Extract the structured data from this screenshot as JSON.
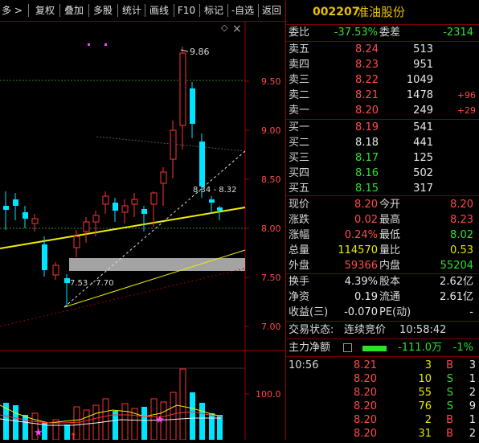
{
  "toolbar": {
    "items": [
      {
        "label": "多 >"
      },
      {
        "label": "复权"
      },
      {
        "label": "叠加"
      },
      {
        "label": "多股"
      },
      {
        "label": "统计"
      },
      {
        "label": "画线"
      },
      {
        "label": "F10"
      },
      {
        "label": "标记"
      },
      {
        "label": "-自选"
      },
      {
        "label": "返回"
      }
    ],
    "diamond_icon": "◇",
    "close_icon": "×"
  },
  "chart": {
    "price_axis": [
      "9.50",
      "9.00",
      "8.50",
      "8.00",
      "7.50",
      "7.00"
    ],
    "high_label": "9.86",
    "range_label": "8.34 - 8.32",
    "low_label": "7.53 - 7.70",
    "volume_axis": "100.0",
    "colors": {
      "up": "#ff3333",
      "down": "#00e5ff",
      "support": "#f0f000",
      "grid": "#2a7a2a"
    }
  },
  "stock": {
    "code": "002207",
    "name": "准油股份"
  },
  "weibi": {
    "label1": "委比",
    "value1": "-37.53%",
    "label2": "委差",
    "value2": "-2314"
  },
  "sell": [
    {
      "label": "卖五",
      "price": "8.24",
      "vol": "513",
      "chg": ""
    },
    {
      "label": "卖四",
      "price": "8.23",
      "vol": "951",
      "chg": ""
    },
    {
      "label": "卖三",
      "price": "8.22",
      "vol": "1049",
      "chg": ""
    },
    {
      "label": "卖二",
      "price": "8.21",
      "vol": "1478",
      "chg": "+96"
    },
    {
      "label": "卖一",
      "price": "8.20",
      "vol": "249",
      "chg": "+29"
    }
  ],
  "buy": [
    {
      "label": "买一",
      "price": "8.19",
      "vol": "541"
    },
    {
      "label": "买二",
      "price": "8.18",
      "vol": "441"
    },
    {
      "label": "买三",
      "price": "8.17",
      "vol": "125"
    },
    {
      "label": "买四",
      "price": "8.16",
      "vol": "502"
    },
    {
      "label": "买五",
      "price": "8.15",
      "vol": "317"
    }
  ],
  "quote": [
    {
      "l1": "现价",
      "v1": "8.20",
      "l2": "今开",
      "v2": "8.20"
    },
    {
      "l1": "涨跌",
      "v1": "0.02",
      "l2": "最高",
      "v2": "8.23"
    },
    {
      "l1": "涨幅",
      "v1": "0.24%",
      "l2": "最低",
      "v2": "8.02"
    },
    {
      "l1": "总量",
      "v1": "114570",
      "l2": "量比",
      "v2": "0.53"
    },
    {
      "l1": "外盘",
      "v1": "59366",
      "l2": "内盘",
      "v2": "55204"
    }
  ],
  "fund": [
    {
      "l1": "换手",
      "v1": "4.39%",
      "l2": "股本",
      "v2": "2.62亿"
    },
    {
      "l1": "净资",
      "v1": "0.19",
      "l2": "流通",
      "v2": "2.61亿"
    },
    {
      "l1": "收益(三)",
      "v1": "-0.070",
      "l2": "PE(动)",
      "v2": "-"
    }
  ],
  "status": {
    "label": "交易状态:",
    "value": "连续竞价",
    "time": "10:58:42"
  },
  "main_flow": {
    "label": "主力净额",
    "value": "-111.0万",
    "pct": "-1%"
  },
  "ticks": [
    {
      "time": "10:56",
      "price": "8.21",
      "vol": "3",
      "side": "B",
      "n": "3"
    },
    {
      "time": "",
      "price": "8.20",
      "vol": "10",
      "side": "S",
      "n": "1"
    },
    {
      "time": "",
      "price": "8.20",
      "vol": "55",
      "side": "S",
      "n": "2"
    },
    {
      "time": "",
      "price": "8.20",
      "vol": "76",
      "side": "S",
      "n": "9"
    },
    {
      "time": "",
      "price": "8.20",
      "vol": "2",
      "side": "B",
      "n": "1"
    },
    {
      "time": "",
      "price": "8.20",
      "vol": "31",
      "side": "B",
      "n": "2"
    }
  ]
}
